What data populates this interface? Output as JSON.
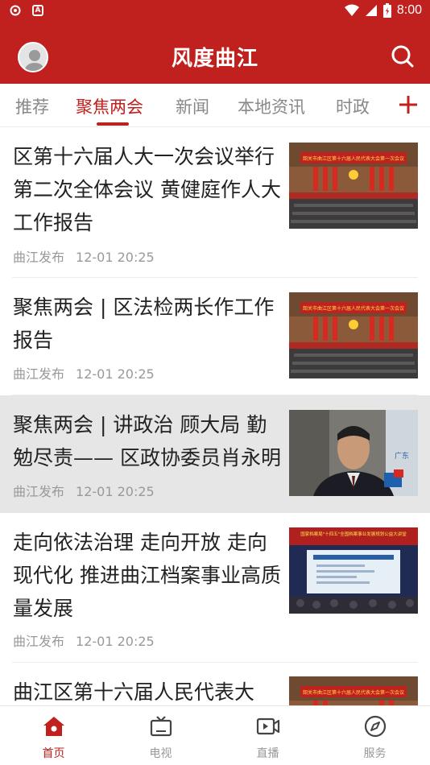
{
  "status_bar": {
    "time": "8:00",
    "left_icons": [
      "notification-icon",
      "a-icon"
    ],
    "right_icons": [
      "wifi-icon",
      "signal-icon",
      "battery-icon"
    ]
  },
  "header": {
    "title": "风度曲江",
    "brand_color": "#c0201e"
  },
  "tabs": [
    {
      "label": "推荐",
      "active": false
    },
    {
      "label": "聚焦两会",
      "active": true
    },
    {
      "label": "新闻",
      "active": false
    },
    {
      "label": "本地资讯",
      "active": false
    },
    {
      "label": "时政",
      "active": false
    }
  ],
  "feed": [
    {
      "title": "区第十六届人大一次会议举行第二次全体会议 黄健庭作人大工作报告",
      "source": "曲江发布",
      "time": "12-01 20:25",
      "thumb_caption": "韶关市曲江区第十六届人民代表大会第一次会议"
    },
    {
      "title": "聚焦两会 | 区法检两长作工作报告",
      "source": "曲江发布",
      "time": "12-01 20:25",
      "thumb_caption": "韶关市曲江区第十六届人民代表大会第一次会议"
    },
    {
      "title": "聚焦两会 | 讲政治 顾大局 勤勉尽责—— 区政协委员肖永明",
      "source": "曲江发布",
      "time": "12-01 20:25",
      "thumb_caption": "广东"
    },
    {
      "title": "走向依法治理 走向开放 走向现代化 推进曲江档案事业高质量发展",
      "source": "曲江发布",
      "time": "12-01 20:25",
      "thumb_caption": "国家档案局\"十四五\"全国档案事业发展规划公益大讲堂"
    },
    {
      "title": "曲江区第十六届人民代表大",
      "source": "",
      "time": "",
      "thumb_caption": "韶关市曲江区第十六届人民代表大会第一次会议"
    }
  ],
  "bottom_nav": [
    {
      "label": "首页",
      "icon": "home-icon",
      "active": true
    },
    {
      "label": "电视",
      "icon": "tv-icon",
      "active": false
    },
    {
      "label": "直播",
      "icon": "live-icon",
      "active": false
    },
    {
      "label": "服务",
      "icon": "compass-icon",
      "active": false
    }
  ]
}
